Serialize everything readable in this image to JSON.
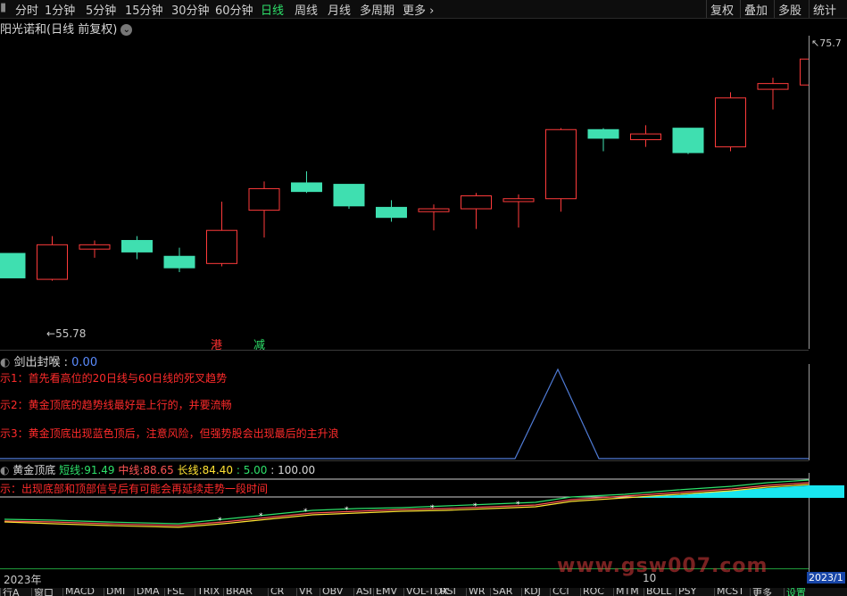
{
  "toolbar": {
    "periods": [
      "分时",
      "1分钟",
      "5分钟",
      "15分钟",
      "30分钟",
      "60分钟",
      "日线",
      "周线",
      "月线",
      "多周期"
    ],
    "more": "更多",
    "right": [
      "复权",
      "叠加",
      "多股",
      "统计"
    ],
    "active_period": "日线"
  },
  "title": "阳光诺和(日线 前复权)",
  "main_chart": {
    "high_label": "75.7",
    "low_label": "55.78",
    "markers": [
      {
        "text": "港",
        "color": "#ff3030"
      },
      {
        "text": "减",
        "color": "#2ee06a"
      }
    ],
    "candles": [
      {
        "o": 61.2,
        "h": 61.2,
        "l": 59.5,
        "c": 59.5,
        "dir": "down"
      },
      {
        "o": 59.4,
        "h": 62.4,
        "l": 59.3,
        "c": 61.8,
        "dir": "up"
      },
      {
        "o": 61.5,
        "h": 62.1,
        "l": 60.9,
        "c": 61.8,
        "dir": "up"
      },
      {
        "o": 62.1,
        "h": 62.4,
        "l": 60.8,
        "c": 61.3,
        "dir": "down"
      },
      {
        "o": 61.0,
        "h": 61.6,
        "l": 59.9,
        "c": 60.2,
        "dir": "down"
      },
      {
        "o": 60.5,
        "h": 64.8,
        "l": 60.3,
        "c": 62.8,
        "dir": "up"
      },
      {
        "o": 64.2,
        "h": 66.2,
        "l": 62.3,
        "c": 65.7,
        "dir": "up"
      },
      {
        "o": 66.1,
        "h": 66.9,
        "l": 65.4,
        "c": 65.5,
        "dir": "down"
      },
      {
        "o": 66.0,
        "h": 66.0,
        "l": 64.3,
        "c": 64.5,
        "dir": "down"
      },
      {
        "o": 64.4,
        "h": 64.9,
        "l": 63.4,
        "c": 63.7,
        "dir": "down"
      },
      {
        "o": 64.1,
        "h": 64.6,
        "l": 62.8,
        "c": 64.3,
        "dir": "up"
      },
      {
        "o": 64.3,
        "h": 65.4,
        "l": 62.9,
        "c": 65.2,
        "dir": "up"
      },
      {
        "o": 64.8,
        "h": 65.3,
        "l": 63.0,
        "c": 65.0,
        "dir": "up"
      },
      {
        "o": 65.0,
        "h": 69.9,
        "l": 64.1,
        "c": 69.8,
        "dir": "up"
      },
      {
        "o": 69.8,
        "h": 69.9,
        "l": 68.3,
        "c": 69.2,
        "dir": "down"
      },
      {
        "o": 69.1,
        "h": 70.1,
        "l": 68.6,
        "c": 69.5,
        "dir": "up"
      },
      {
        "o": 69.9,
        "h": 69.9,
        "l": 68.1,
        "c": 68.2,
        "dir": "down"
      },
      {
        "o": 68.6,
        "h": 72.4,
        "l": 68.3,
        "c": 72.0,
        "dir": "up"
      },
      {
        "o": 72.6,
        "h": 73.4,
        "l": 71.2,
        "c": 73.0,
        "dir": "up"
      },
      {
        "o": 72.9,
        "h": 75.7,
        "l": 71.8,
        "c": 74.7,
        "dir": "up"
      }
    ]
  },
  "panel2": {
    "name": "剑出封喉",
    "value": "0.00",
    "hints": [
      "示1：首先看高位的20日线与60日线的死叉趋势",
      "示2：黄金顶底的趋势线最好是上行的，并要流畅",
      "示3：黄金顶底出现蓝色顶后，注意风险，但强势股会出现最后的主升浪"
    ]
  },
  "panel3": {
    "name": "黄金顶底",
    "short_label": "短线:",
    "short_value": "91.49",
    "mid_label": "中线:",
    "mid_value": "88.65",
    "long_label": "长线:",
    "long_value": "84.40",
    "v1": ": 5.00",
    "v2": ": 100.00",
    "hint": "示：出现底部和顶部信号后有可能会再延续走势一段时间"
  },
  "axis": {
    "year": "2023年",
    "mid": "10",
    "right": "2023/1"
  },
  "watermark": "www.gsw007.com",
  "bottombar": [
    "行A",
    "窗口",
    "MACD",
    "DMI",
    "DMA",
    "FSL",
    "TRIX",
    "BRAR",
    "CR",
    "VR",
    "OBV",
    "ASI",
    "EMV",
    "VOL-TDX",
    "RSI",
    "WR",
    "SAR",
    "KDJ",
    "CCI",
    "ROC",
    "MTM",
    "BOLL",
    "PSY",
    "MCST",
    "更多",
    "设置"
  ],
  "colors": {
    "up": "#ff3b3b",
    "down": "#3fdfb0",
    "active": "#2ee06a",
    "cyan": "#19e6f0"
  }
}
